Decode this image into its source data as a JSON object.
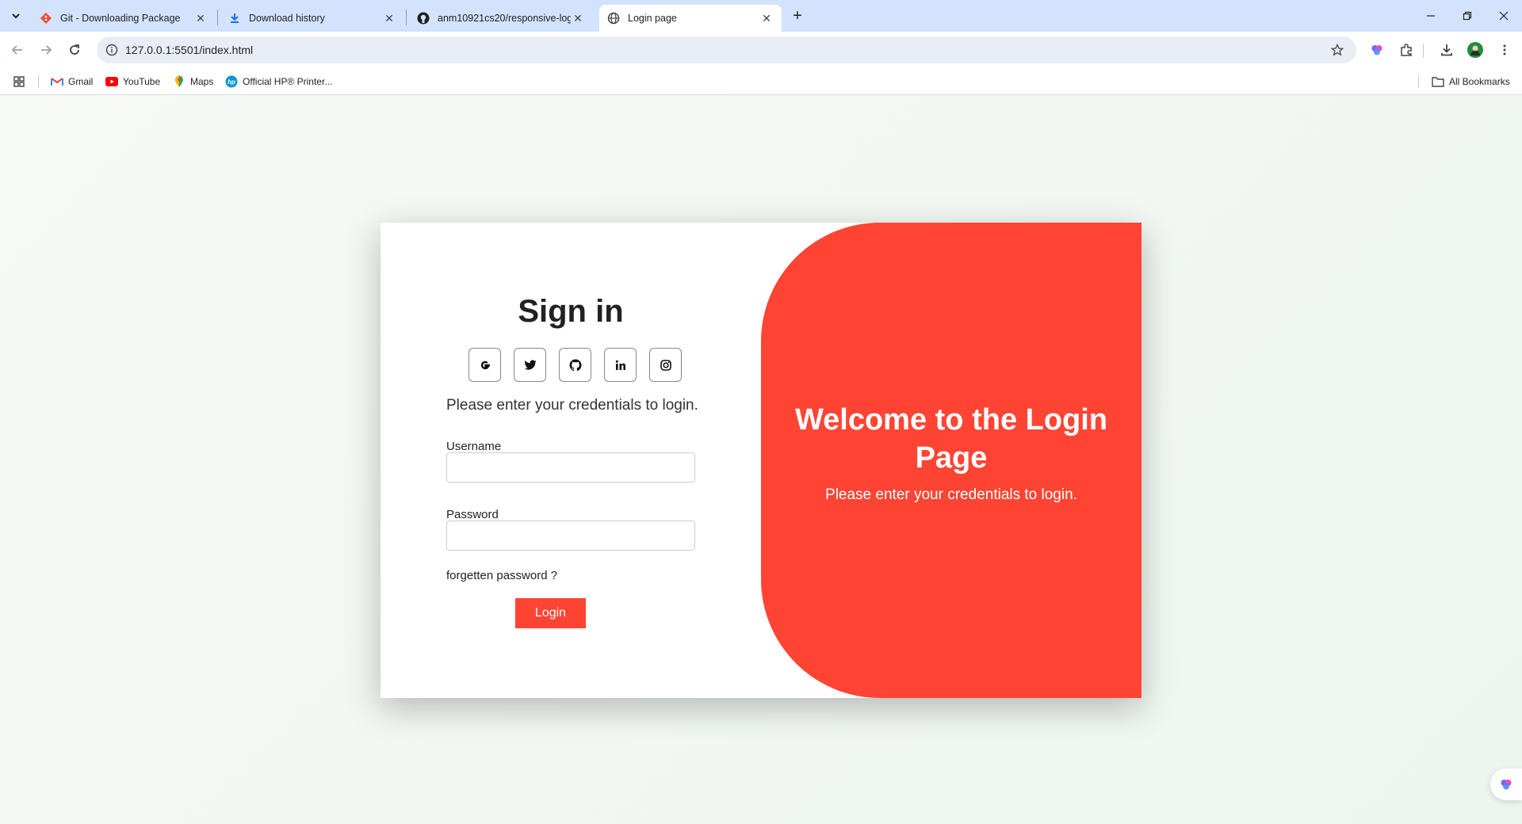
{
  "browser": {
    "tabs": [
      {
        "title": "Git - Downloading Package",
        "icon": "git-icon",
        "active": false
      },
      {
        "title": "Download history",
        "icon": "download-icon",
        "active": false
      },
      {
        "title": "anm10921cs20/responsive-logi",
        "icon": "github-icon",
        "active": false
      },
      {
        "title": "Login page",
        "icon": "globe-icon",
        "active": true
      }
    ],
    "url": "127.0.0.1:5501/index.html",
    "bookmarks": [
      {
        "label": "Gmail",
        "icon": "gmail-icon"
      },
      {
        "label": "YouTube",
        "icon": "youtube-icon"
      },
      {
        "label": "Maps",
        "icon": "maps-icon"
      },
      {
        "label": "Official HP® Printer...",
        "icon": "hp-icon"
      }
    ],
    "all_bookmarks": "All Bookmarks"
  },
  "login": {
    "title": "Sign in",
    "socials": [
      "google-icon",
      "twitter-icon",
      "github-icon",
      "linkedin-icon",
      "instagram-icon"
    ],
    "hint": "Please enter your credentials to login.",
    "username_label": "Username",
    "username_value": "",
    "password_label": "Password",
    "password_value": "",
    "forgot": "forgetten password ?",
    "button": "Login"
  },
  "welcome": {
    "title": "Welcome to the Login Page",
    "subtitle": "Please enter your credentials to login."
  },
  "colors": {
    "accent": "#ff4433",
    "tabstrip": "#d3e3fd"
  }
}
